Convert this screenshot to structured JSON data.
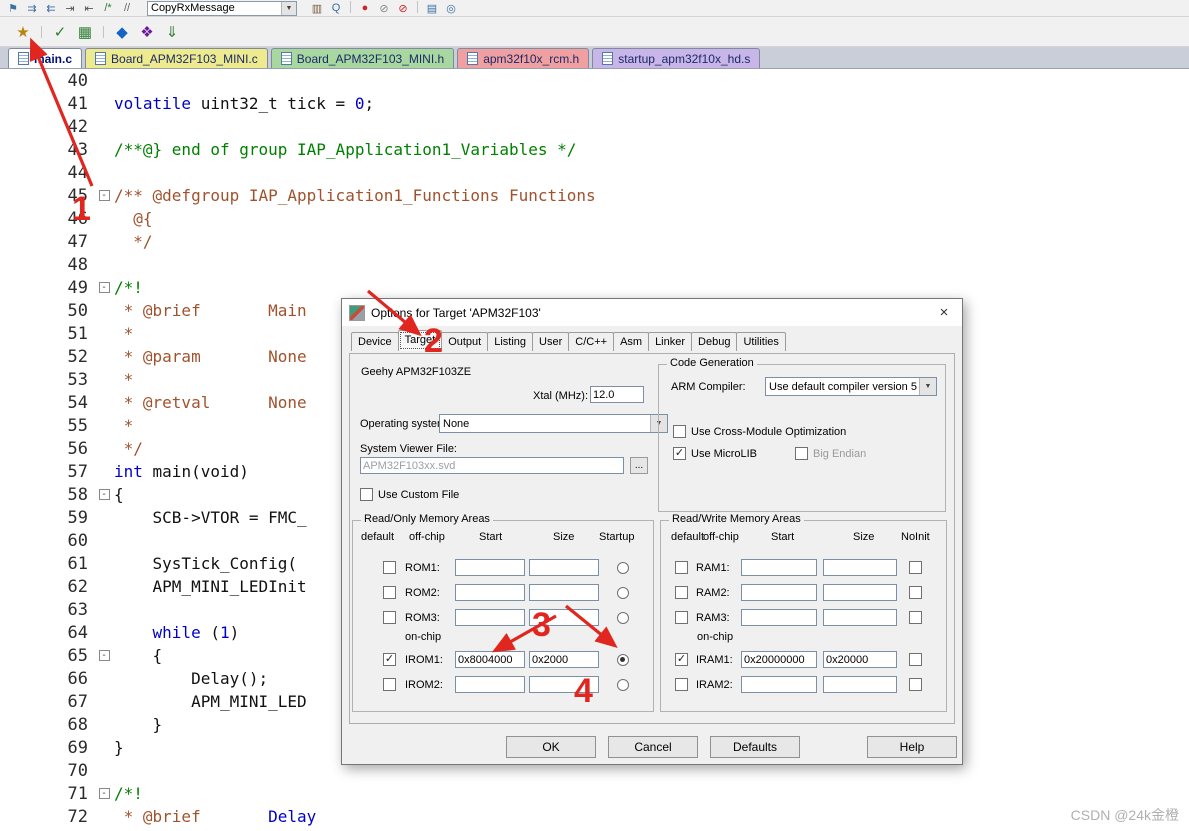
{
  "glyphs": {
    "check": "✓",
    "chevron_down": "▼",
    "close": "×",
    "fold_minus": "-"
  },
  "toolbar_top": {
    "combo_value": "CopyRxMessage",
    "left_icons": [
      {
        "name": "toggle-bookmark-icon",
        "glyph": "⚑",
        "color": "#3a6ea5"
      },
      {
        "name": "next-bookmark-icon",
        "glyph": "⇉",
        "color": "#3a6ea5"
      },
      {
        "name": "prev-bookmark-icon",
        "glyph": "⇇",
        "color": "#3a6ea5"
      },
      {
        "name": "indent-icon",
        "glyph": "⇥",
        "color": "#555555"
      },
      {
        "name": "outdent-icon",
        "glyph": "⇤",
        "color": "#555555"
      },
      {
        "name": "comment-selection-icon",
        "glyph": "/*",
        "color": "#2e7d32"
      },
      {
        "name": "uncomment-selection-icon",
        "glyph": "//",
        "color": "#666666"
      }
    ],
    "right_icons": [
      {
        "name": "open-book-icon",
        "glyph": "▥",
        "color": "#7a5c3a"
      },
      {
        "name": "find-in-files-icon",
        "glyph": "Q",
        "color": "#3a6ea5"
      },
      {
        "sep": true
      },
      {
        "name": "insert-breakpoint-icon",
        "glyph": "●",
        "color": "#c62828"
      },
      {
        "name": "disable-breakpoint-icon",
        "glyph": "⊘",
        "color": "#888888"
      },
      {
        "name": "kill-breakpoints-icon",
        "glyph": "⊘",
        "color": "#c62828"
      },
      {
        "sep": true
      },
      {
        "name": "periodic-window-icon",
        "glyph": "▤",
        "color": "#3a6ea5"
      },
      {
        "name": "search-icon",
        "glyph": "◎",
        "color": "#3a6ea5"
      }
    ]
  },
  "toolbar_build": {
    "icons": [
      {
        "name": "options-for-target-icon",
        "glyph": "★",
        "color": "#b8860b"
      },
      {
        "sep": true
      },
      {
        "name": "translate-icon",
        "glyph": "✓",
        "color": "#2e7d32"
      },
      {
        "name": "build-icon",
        "glyph": "▦",
        "color": "#2e7d32"
      },
      {
        "sep": true
      },
      {
        "name": "batch-build-icon",
        "glyph": "◆",
        "color": "#1565c0"
      },
      {
        "name": "rebuild-icon",
        "glyph": "❖",
        "color": "#6a1b9a"
      },
      {
        "name": "download-icon",
        "glyph": "⇓",
        "color": "#2e7d32"
      }
    ]
  },
  "tabs": [
    {
      "label": "main.c",
      "color": "#ffffff",
      "active": true
    },
    {
      "label": "Board_APM32F103_MINI.c",
      "color": "#eeea8e"
    },
    {
      "label": "Board_APM32F103_MINI.h",
      "color": "#a8d8a0"
    },
    {
      "label": "apm32f10x_rcm.h",
      "color": "#f0a0a0"
    },
    {
      "label": "startup_apm32f10x_hd.s",
      "color": "#c9b6e8"
    }
  ],
  "editor": {
    "lines": [
      {
        "num": 40,
        "segs": []
      },
      {
        "num": 41,
        "segs": [
          [
            "k",
            "volatile"
          ],
          [
            "p",
            " uint32_t tick = "
          ],
          [
            "n",
            "0"
          ],
          [
            "p",
            ";"
          ]
        ]
      },
      {
        "num": 42,
        "segs": []
      },
      {
        "num": 43,
        "segs": [
          [
            "c",
            "/**@} end of group IAP_Application1_Variables */"
          ]
        ]
      },
      {
        "num": 44,
        "segs": []
      },
      {
        "num": 45,
        "fold": true,
        "segs": [
          [
            "d",
            "/** @defgroup IAP_Application1_Functions Functions"
          ]
        ]
      },
      {
        "num": 46,
        "segs": [
          [
            "d",
            "  @{"
          ]
        ]
      },
      {
        "num": 47,
        "segs": [
          [
            "d",
            "  */"
          ]
        ]
      },
      {
        "num": 48,
        "segs": []
      },
      {
        "num": 49,
        "fold": true,
        "segs": [
          [
            "c",
            "/*!"
          ]
        ]
      },
      {
        "num": 50,
        "segs": [
          [
            "d",
            " * @brief       Main"
          ]
        ]
      },
      {
        "num": 51,
        "segs": [
          [
            "d",
            " *"
          ]
        ]
      },
      {
        "num": 52,
        "segs": [
          [
            "d",
            " * @param       None"
          ]
        ]
      },
      {
        "num": 53,
        "segs": [
          [
            "d",
            " *"
          ]
        ]
      },
      {
        "num": 54,
        "segs": [
          [
            "d",
            " * @retval      None"
          ]
        ]
      },
      {
        "num": 55,
        "segs": [
          [
            "d",
            " *"
          ]
        ]
      },
      {
        "num": 56,
        "segs": [
          [
            "d",
            " */"
          ]
        ]
      },
      {
        "num": 57,
        "segs": [
          [
            "k",
            "int"
          ],
          [
            "p",
            " main(void)"
          ]
        ]
      },
      {
        "num": 58,
        "fold": true,
        "segs": [
          [
            "p",
            "{"
          ]
        ]
      },
      {
        "num": 59,
        "segs": [
          [
            "p",
            "    SCB->VTOR = FMC_"
          ]
        ]
      },
      {
        "num": 60,
        "segs": []
      },
      {
        "num": 61,
        "segs": [
          [
            "p",
            "    SysTick_Config("
          ]
        ]
      },
      {
        "num": 62,
        "segs": [
          [
            "p",
            "    APM_MINI_LEDInit"
          ]
        ]
      },
      {
        "num": 63,
        "segs": []
      },
      {
        "num": 64,
        "segs": [
          [
            "p",
            "    "
          ],
          [
            "k",
            "while"
          ],
          [
            "p",
            " ("
          ],
          [
            "n",
            "1"
          ],
          [
            "p",
            ")"
          ]
        ]
      },
      {
        "num": 65,
        "fold": true,
        "segs": [
          [
            "p",
            "    {"
          ]
        ]
      },
      {
        "num": 66,
        "segs": [
          [
            "p",
            "        Delay();"
          ]
        ]
      },
      {
        "num": 67,
        "segs": [
          [
            "p",
            "        APM_MINI_LED"
          ]
        ]
      },
      {
        "num": 68,
        "segs": [
          [
            "p",
            "    }"
          ]
        ]
      },
      {
        "num": 69,
        "segs": [
          [
            "p",
            "}"
          ]
        ]
      },
      {
        "num": 70,
        "segs": []
      },
      {
        "num": 71,
        "fold": true,
        "segs": [
          [
            "c",
            "/*!"
          ]
        ]
      },
      {
        "num": 72,
        "segs": [
          [
            "d",
            " * @brief       "
          ],
          [
            "k",
            "Delay"
          ]
        ]
      }
    ]
  },
  "dialog": {
    "title": "Options for Target 'APM32F103'",
    "tabs": [
      {
        "label": "Device"
      },
      {
        "label": "Target",
        "selected": true
      },
      {
        "label": "Output"
      },
      {
        "label": "Listing"
      },
      {
        "label": "User"
      },
      {
        "label": "C/C++"
      },
      {
        "label": "Asm"
      },
      {
        "label": "Linker"
      },
      {
        "label": "Debug"
      },
      {
        "label": "Utilities"
      }
    ],
    "device_label": "Geehy APM32F103ZE",
    "xtal_label": "Xtal (MHz):",
    "xtal_value": "12.0",
    "os_label": "Operating system:",
    "os_value": "None",
    "svf_label": "System Viewer File:",
    "svf_value": "APM32F103xx.svd",
    "browse_label": "...",
    "use_custom_file_label": "Use Custom File",
    "code_generation": {
      "title": "Code Generation",
      "arm_compiler_label": "ARM Compiler:",
      "arm_compiler_value": "Use default compiler version 5",
      "cross_module_label": "Use Cross-Module Optimization",
      "microlib_label": "Use MicroLIB",
      "big_endian_label": "Big Endian"
    },
    "read_only": {
      "title": "Read/Only Memory Areas",
      "headers": [
        "default",
        "off-chip",
        "Start",
        "Size",
        "Startup"
      ],
      "last_col": "radio",
      "rows": [
        {
          "label": "ROM1:",
          "checked": false,
          "start": "",
          "size": "",
          "last": false
        },
        {
          "label": "ROM2:",
          "checked": false,
          "start": "",
          "size": "",
          "last": false
        },
        {
          "label": "ROM3:",
          "checked": false,
          "start": "",
          "size": "",
          "last": false
        },
        {
          "section": "on-chip"
        },
        {
          "label": "IROM1:",
          "checked": true,
          "start": "0x8004000",
          "size": "0x2000",
          "last": true
        },
        {
          "label": "IROM2:",
          "checked": false,
          "start": "",
          "size": "",
          "last": false
        }
      ]
    },
    "read_write": {
      "title": "Read/Write Memory Areas",
      "headers": [
        "default",
        "off-chip",
        "Start",
        "Size",
        "NoInit"
      ],
      "last_col": "checkbox",
      "rows": [
        {
          "label": "RAM1:",
          "checked": false,
          "start": "",
          "size": "",
          "last": false
        },
        {
          "label": "RAM2:",
          "checked": false,
          "start": "",
          "size": "",
          "last": false
        },
        {
          "label": "RAM3:",
          "checked": false,
          "start": "",
          "size": "",
          "last": false
        },
        {
          "section": "on-chip"
        },
        {
          "label": "IRAM1:",
          "checked": true,
          "start": "0x20000000",
          "size": "0x20000",
          "last": false
        },
        {
          "label": "IRAM2:",
          "checked": false,
          "start": "",
          "size": "",
          "last": false
        }
      ]
    },
    "buttons": [
      "OK",
      "Cancel",
      "Defaults",
      "Help"
    ]
  },
  "annotations": {
    "numbers": [
      "1",
      "2",
      "3",
      "4"
    ]
  },
  "watermark": "CSDN @24k金橙"
}
